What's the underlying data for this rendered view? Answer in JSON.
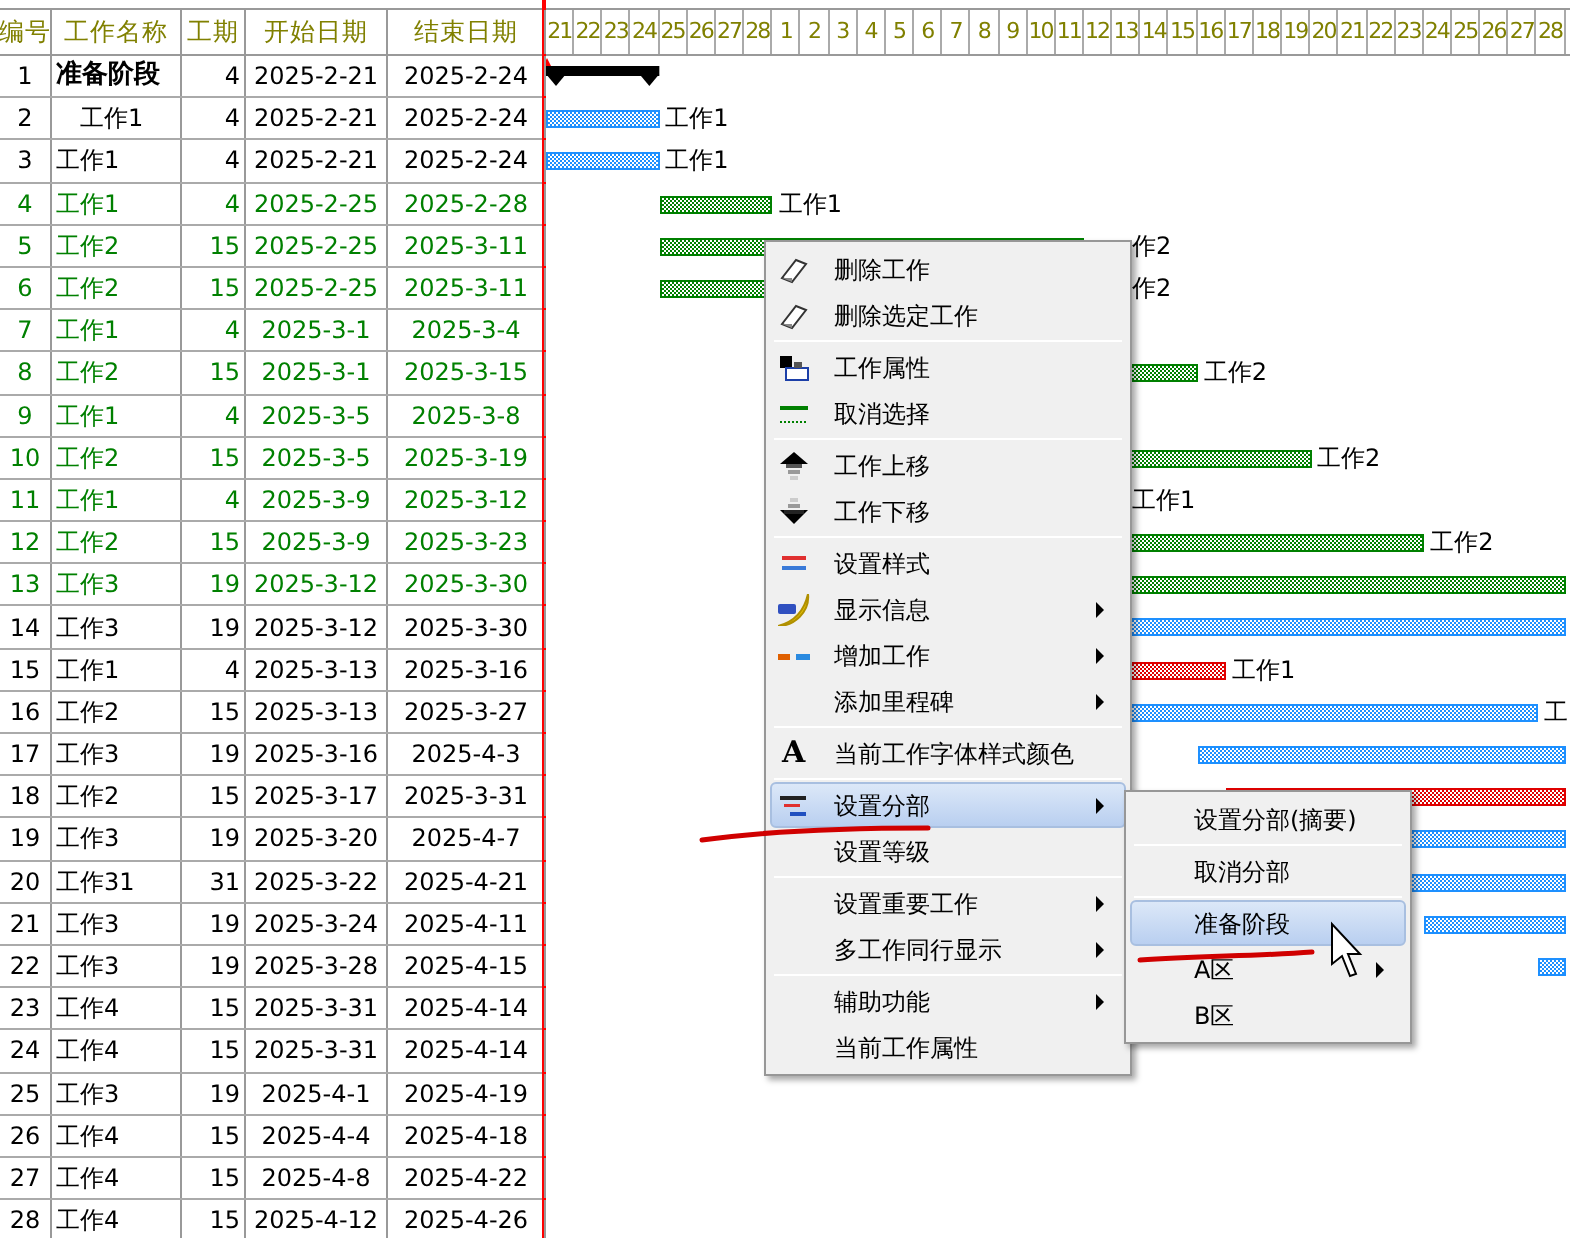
{
  "table": {
    "columns": [
      "编号",
      "工作名称",
      "工期",
      "开始日期",
      "结束日期"
    ],
    "rows": [
      {
        "id": "1",
        "name": "准备阶段",
        "duration": "4",
        "start": "2025-2-21",
        "end": "2025-2-24",
        "kind": "summary",
        "color": "#000000",
        "children": [
          {
            "id": "2",
            "name": "工作1",
            "duration": "4",
            "start": "2025-2-21",
            "end": "2025-2-24",
            "kind": "task",
            "color": "#000000",
            "bar": {
              "color": "#1e90ff"
            },
            "bar_label": "工作1"
          }
        ]
      },
      {
        "id": "3",
        "name": "工作1",
        "duration": "4",
        "start": "2025-2-21",
        "end": "2025-2-24",
        "kind": "task",
        "color": "#000000",
        "bar": {
          "color": "#1e90ff"
        },
        "bar_label": "工作1"
      },
      {
        "id": "4",
        "name": "工作1",
        "duration": "4",
        "start": "2025-2-25",
        "end": "2025-2-28",
        "kind": "task",
        "color": "#008000",
        "bar": {
          "color": "#008000"
        },
        "bar_label": "工作1"
      },
      {
        "id": "5",
        "name": "工作2",
        "duration": "15",
        "start": "2025-2-25",
        "end": "2025-3-11",
        "kind": "task",
        "color": "#008000",
        "bar": {
          "color": "#008000"
        },
        "bar_label": "作2"
      },
      {
        "id": "6",
        "name": "工作2",
        "duration": "15",
        "start": "2025-2-25",
        "end": "2025-3-11",
        "kind": "task",
        "color": "#008000",
        "bar": {
          "color": "#008000"
        },
        "bar_label": "作2"
      },
      {
        "id": "7",
        "name": "工作1",
        "duration": "4",
        "start": "2025-3-1",
        "end": "2025-3-4",
        "kind": "task",
        "color": "#008000"
      },
      {
        "id": "8",
        "name": "工作2",
        "duration": "15",
        "start": "2025-3-1",
        "end": "2025-3-15",
        "kind": "task",
        "color": "#008000",
        "bar": {
          "color": "#008000"
        },
        "bar_label": "工作2"
      },
      {
        "id": "9",
        "name": "工作1",
        "duration": "4",
        "start": "2025-3-5",
        "end": "2025-3-8",
        "kind": "task",
        "color": "#008000"
      },
      {
        "id": "10",
        "name": "工作2",
        "duration": "15",
        "start": "2025-3-5",
        "end": "2025-3-19",
        "kind": "task",
        "color": "#008000",
        "bar": {
          "color": "#008000"
        },
        "bar_label": "工作2"
      },
      {
        "id": "11",
        "name": "工作1",
        "duration": "4",
        "start": "2025-3-9",
        "end": "2025-3-12",
        "kind": "task",
        "color": "#008000",
        "bar_label": "工作1"
      },
      {
        "id": "12",
        "name": "工作2",
        "duration": "15",
        "start": "2025-3-9",
        "end": "2025-3-23",
        "kind": "task",
        "color": "#008000",
        "bar": {
          "color": "#008000"
        },
        "bar_label": "工作2"
      },
      {
        "id": "13",
        "name": "工作3",
        "duration": "19",
        "start": "2025-3-12",
        "end": "2025-3-30",
        "kind": "task",
        "color": "#008000",
        "bar": {
          "color": "#008000"
        }
      },
      {
        "id": "14",
        "name": "工作3",
        "duration": "19",
        "start": "2025-3-12",
        "end": "2025-3-30",
        "kind": "task",
        "color": "#000000",
        "bar": {
          "color": "#1e90ff"
        }
      },
      {
        "id": "15",
        "name": "工作1",
        "duration": "4",
        "start": "2025-3-13",
        "end": "2025-3-16",
        "kind": "task",
        "color": "#000000",
        "bar": {
          "color": "#e00000"
        },
        "bar_label": "工作1"
      },
      {
        "id": "16",
        "name": "工作2",
        "duration": "15",
        "start": "2025-3-13",
        "end": "2025-3-27",
        "kind": "task",
        "color": "#000000",
        "bar": {
          "color": "#1e90ff"
        },
        "bar_label": "工"
      },
      {
        "id": "17",
        "name": "工作3",
        "duration": "19",
        "start": "2025-3-16",
        "end": "2025-4-3",
        "kind": "task",
        "color": "#000000",
        "bar": {
          "color": "#1e90ff"
        }
      },
      {
        "id": "18",
        "name": "工作2",
        "duration": "15",
        "start": "2025-3-17",
        "end": "2025-3-31",
        "kind": "task",
        "color": "#000000",
        "bar": {
          "color": "#e00000"
        }
      },
      {
        "id": "19",
        "name": "工作3",
        "duration": "19",
        "start": "2025-3-20",
        "end": "2025-4-7",
        "kind": "task",
        "color": "#000000",
        "bar": {
          "color": "#1e90ff"
        }
      },
      {
        "id": "20",
        "name": "工作31",
        "duration": "31",
        "start": "2025-3-22",
        "end": "2025-4-21",
        "kind": "task",
        "color": "#000000",
        "bar": {
          "color": "#1e90ff"
        }
      },
      {
        "id": "21",
        "name": "工作3",
        "duration": "19",
        "start": "2025-3-24",
        "end": "2025-4-11",
        "kind": "task",
        "color": "#000000",
        "bar": {
          "color": "#1e90ff"
        }
      },
      {
        "id": "22",
        "name": "工作3",
        "duration": "19",
        "start": "2025-3-28",
        "end": "2025-4-15",
        "kind": "task",
        "color": "#000000",
        "bar": {
          "color": "#1e90ff"
        }
      },
      {
        "id": "23",
        "name": "工作4",
        "duration": "15",
        "start": "2025-3-31",
        "end": "2025-4-14",
        "kind": "task",
        "color": "#000000"
      },
      {
        "id": "24",
        "name": "工作4",
        "duration": "15",
        "start": "2025-3-31",
        "end": "2025-4-14",
        "kind": "task",
        "color": "#000000"
      },
      {
        "id": "25",
        "name": "工作3",
        "duration": "19",
        "start": "2025-4-1",
        "end": "2025-4-19",
        "kind": "task",
        "color": "#000000"
      },
      {
        "id": "26",
        "name": "工作4",
        "duration": "15",
        "start": "2025-4-4",
        "end": "2025-4-18",
        "kind": "task",
        "color": "#000000"
      },
      {
        "id": "27",
        "name": "工作4",
        "duration": "15",
        "start": "2025-4-8",
        "end": "2025-4-22",
        "kind": "task",
        "color": "#000000"
      },
      {
        "id": "28",
        "name": "工作4",
        "duration": "15",
        "start": "2025-4-12",
        "end": "2025-4-26",
        "kind": "task",
        "color": "#000000"
      }
    ]
  },
  "gantt": {
    "days": [
      "21",
      "22",
      "23",
      "24",
      "25",
      "26",
      "27",
      "28",
      "1",
      "2",
      "3",
      "4",
      "5",
      "6",
      "7",
      "8",
      "9",
      "10",
      "11",
      "12",
      "13",
      "14",
      "15",
      "16",
      "17",
      "18",
      "19",
      "20",
      "21",
      "22",
      "23",
      "24",
      "25",
      "26",
      "27",
      "28"
    ]
  },
  "context_menu": {
    "groups": [
      [
        {
          "label": "删除工作",
          "selected": false,
          "submenu": false
        },
        {
          "label": "删除选定工作",
          "selected": false,
          "submenu": false
        }
      ],
      [
        {
          "label": "工作属性",
          "selected": false,
          "submenu": false
        },
        {
          "label": "取消选择",
          "selected": false,
          "submenu": false
        }
      ],
      [
        {
          "label": "工作上移",
          "selected": false,
          "submenu": false
        },
        {
          "label": "工作下移",
          "selected": false,
          "submenu": false
        }
      ],
      [
        {
          "label": "设置样式",
          "selected": false,
          "submenu": false
        },
        {
          "label": "显示信息",
          "selected": false,
          "submenu": true
        },
        {
          "label": "增加工作",
          "selected": false,
          "submenu": true
        },
        {
          "label": "添加里程碑",
          "selected": false,
          "submenu": true
        }
      ],
      [
        {
          "label": "当前工作字体样式颜色",
          "glyph": "A",
          "selected": false,
          "submenu": false
        }
      ],
      [
        {
          "label": "设置分部",
          "selected": true,
          "submenu": true
        },
        {
          "label": "设置等级",
          "selected": false,
          "submenu": false
        }
      ],
      [
        {
          "label": "设置重要工作",
          "selected": false,
          "submenu": true
        },
        {
          "label": "多工作同行显示",
          "selected": false,
          "submenu": true
        }
      ],
      [
        {
          "label": "辅助功能",
          "selected": false,
          "submenu": true
        },
        {
          "label": "当前工作属性",
          "selected": false,
          "submenu": false
        }
      ]
    ]
  },
  "submenu": {
    "groups": [
      [
        {
          "label": "设置分部(摘要)",
          "selected": false,
          "submenu": false
        }
      ],
      [
        {
          "label": "取消分部",
          "selected": false,
          "submenu": false
        }
      ],
      [
        {
          "label": "准备阶段",
          "selected": true,
          "submenu": false
        },
        {
          "label": "A区",
          "selected": false,
          "submenu": true
        },
        {
          "label": "B区",
          "selected": false,
          "submenu": false
        }
      ]
    ]
  }
}
